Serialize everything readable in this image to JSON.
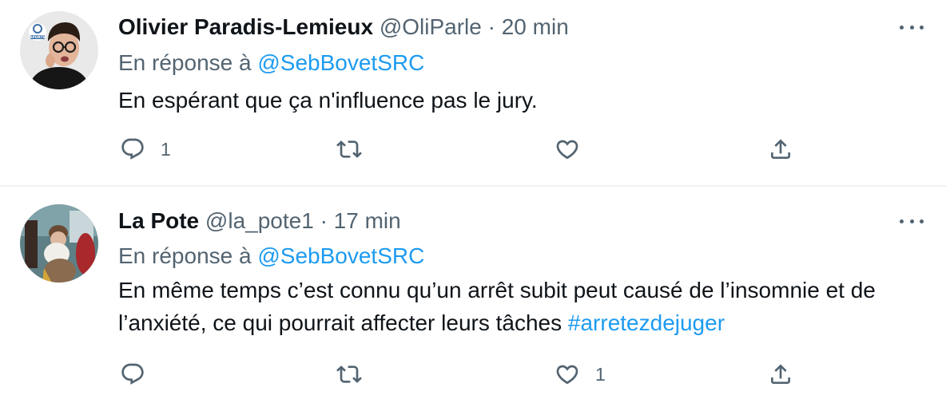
{
  "tweets": [
    {
      "author_name": "Olivier Paradis-Lemieux",
      "handle": "@OliParle",
      "separator": "·",
      "time": "20 min",
      "reply_prefix": "En réponse à",
      "reply_to": "@SebBovetSRC",
      "text": "En espérant que ça n'influence pas le jury.",
      "hashtag": "",
      "replies": "1",
      "retweets": "",
      "likes": "",
      "avatar_badge": "SPORTS"
    },
    {
      "author_name": "La Pote",
      "handle": "@la_pote1",
      "separator": "·",
      "time": "17 min",
      "reply_prefix": "En réponse à",
      "reply_to": "@SebBovetSRC",
      "text": "En même temps c’est connu qu’un arrêt subit peut causé de l’insomnie et de l’anxiété, ce qui pourrait affecter leurs tâches ",
      "hashtag": "#arretezdejuger",
      "replies": "",
      "retweets": "",
      "likes": "1"
    }
  ],
  "icons": {
    "reply": "reply-icon",
    "retweet": "retweet-icon",
    "like": "heart-icon",
    "share": "share-icon",
    "more": "more-options-icon"
  },
  "colors": {
    "link": "#1d9bf0",
    "secondary_text": "#536471",
    "primary_text": "#0f1419",
    "divider": "#eff3f4"
  }
}
